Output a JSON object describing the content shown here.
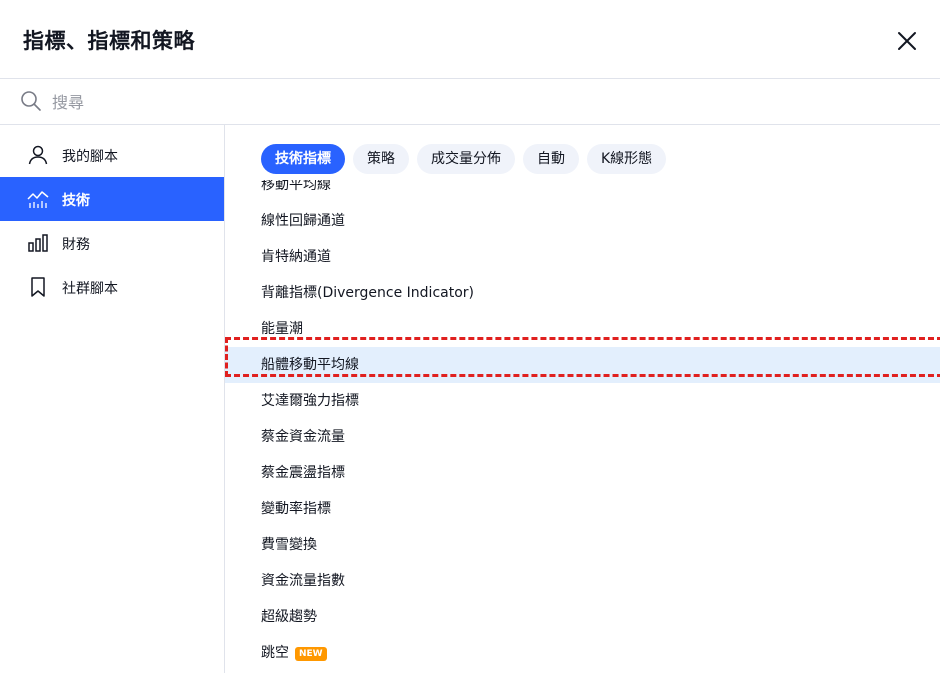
{
  "dialog": {
    "title": "指標、指標和策略",
    "close_icon": "close-icon"
  },
  "search": {
    "placeholder": "搜尋",
    "value": "",
    "icon": "search-icon"
  },
  "sidebar": {
    "items": [
      {
        "label": "我的腳本",
        "icon": "user-icon",
        "active": false
      },
      {
        "label": "技術",
        "icon": "chart-icon",
        "active": true
      },
      {
        "label": "財務",
        "icon": "bar-chart-icon",
        "active": false
      },
      {
        "label": "社群腳本",
        "icon": "bookmark-icon",
        "active": false
      }
    ],
    "accent_color": "#2962ff"
  },
  "tabs": [
    {
      "label": "技術指標",
      "active": true
    },
    {
      "label": "策略",
      "active": false
    },
    {
      "label": "成交量分佈",
      "active": false
    },
    {
      "label": "自動",
      "active": false
    },
    {
      "label": "K線形態",
      "active": false
    }
  ],
  "list": {
    "partial_item": "移動平均線",
    "items": [
      {
        "label": "線性回歸通道"
      },
      {
        "label": "肯特納通道"
      },
      {
        "label": "背離指標(Divergence Indicator)"
      },
      {
        "label": "能量潮"
      },
      {
        "label": "船體移動平均線",
        "highlighted": true
      },
      {
        "label": "艾達爾強力指標"
      },
      {
        "label": "蔡金資金流量"
      },
      {
        "label": "蔡金震盪指標"
      },
      {
        "label": "變動率指標"
      },
      {
        "label": "費雪變換"
      },
      {
        "label": "資金流量指數"
      },
      {
        "label": "超級趨勢"
      },
      {
        "label": "跳空",
        "badge": "NEW"
      }
    ],
    "badge_color": "#ff9800",
    "highlight_color": "#e3effd"
  },
  "annotation": {
    "color": "#e0201f",
    "style": "dashed"
  }
}
